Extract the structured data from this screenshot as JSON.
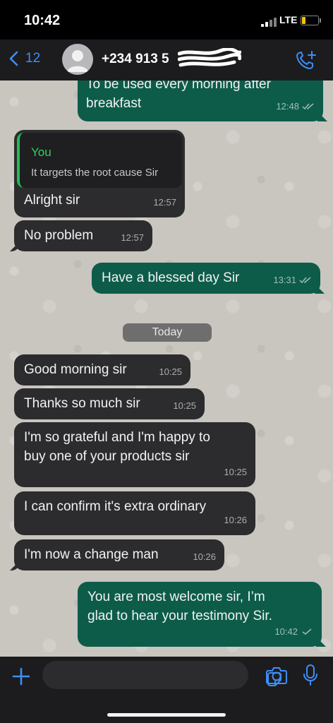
{
  "status_bar": {
    "time": "10:42",
    "network": "LTE"
  },
  "header": {
    "back_count": "12",
    "contact_name": "+234 913 5",
    "icons": {
      "back": "chevron-left-icon",
      "avatar": "person-icon",
      "call": "phone-plus-icon"
    }
  },
  "colors": {
    "incoming_bubble": "#2c2c2e",
    "outgoing_bubble": "#0d5c4a",
    "accent": "#3d8ef7",
    "quote_name": "#2ad45b",
    "chat_background": "#c9c5bf"
  },
  "messages": [
    {
      "direction": "out",
      "text": "To be used every morning after\nbreakfast",
      "time": "12:48",
      "read": true
    },
    {
      "direction": "in",
      "quote": {
        "author": "You",
        "text": "It targets the root cause Sir"
      },
      "text": "Alright sir",
      "time": "12:57"
    },
    {
      "direction": "in",
      "text": "No problem",
      "time": "12:57"
    },
    {
      "direction": "out",
      "text": "Have a blessed day Sir",
      "time": "13:31",
      "read": true
    },
    {
      "direction": "in",
      "text": "Good morning sir",
      "time": "10:25"
    },
    {
      "direction": "in",
      "text": "Thanks so much sir",
      "time": "10:25"
    },
    {
      "direction": "in",
      "text": "I'm so grateful and I'm happy to\nbuy one of your products sir",
      "time": "10:25"
    },
    {
      "direction": "in",
      "text": "I can confirm it's extra ordinary",
      "time": "10:26"
    },
    {
      "direction": "in",
      "text": "I'm now a change man",
      "time": "10:26"
    },
    {
      "direction": "out",
      "text": "You are most welcome sir, I’m\nglad to hear your testimony Sir.",
      "time": "10:42",
      "read": false
    }
  ],
  "date_separator": "Today",
  "input_bar": {
    "icons": {
      "attach": "plus-icon",
      "sticker": "sticker-icon",
      "camera": "camera-icon",
      "mic": "microphone-icon"
    }
  }
}
